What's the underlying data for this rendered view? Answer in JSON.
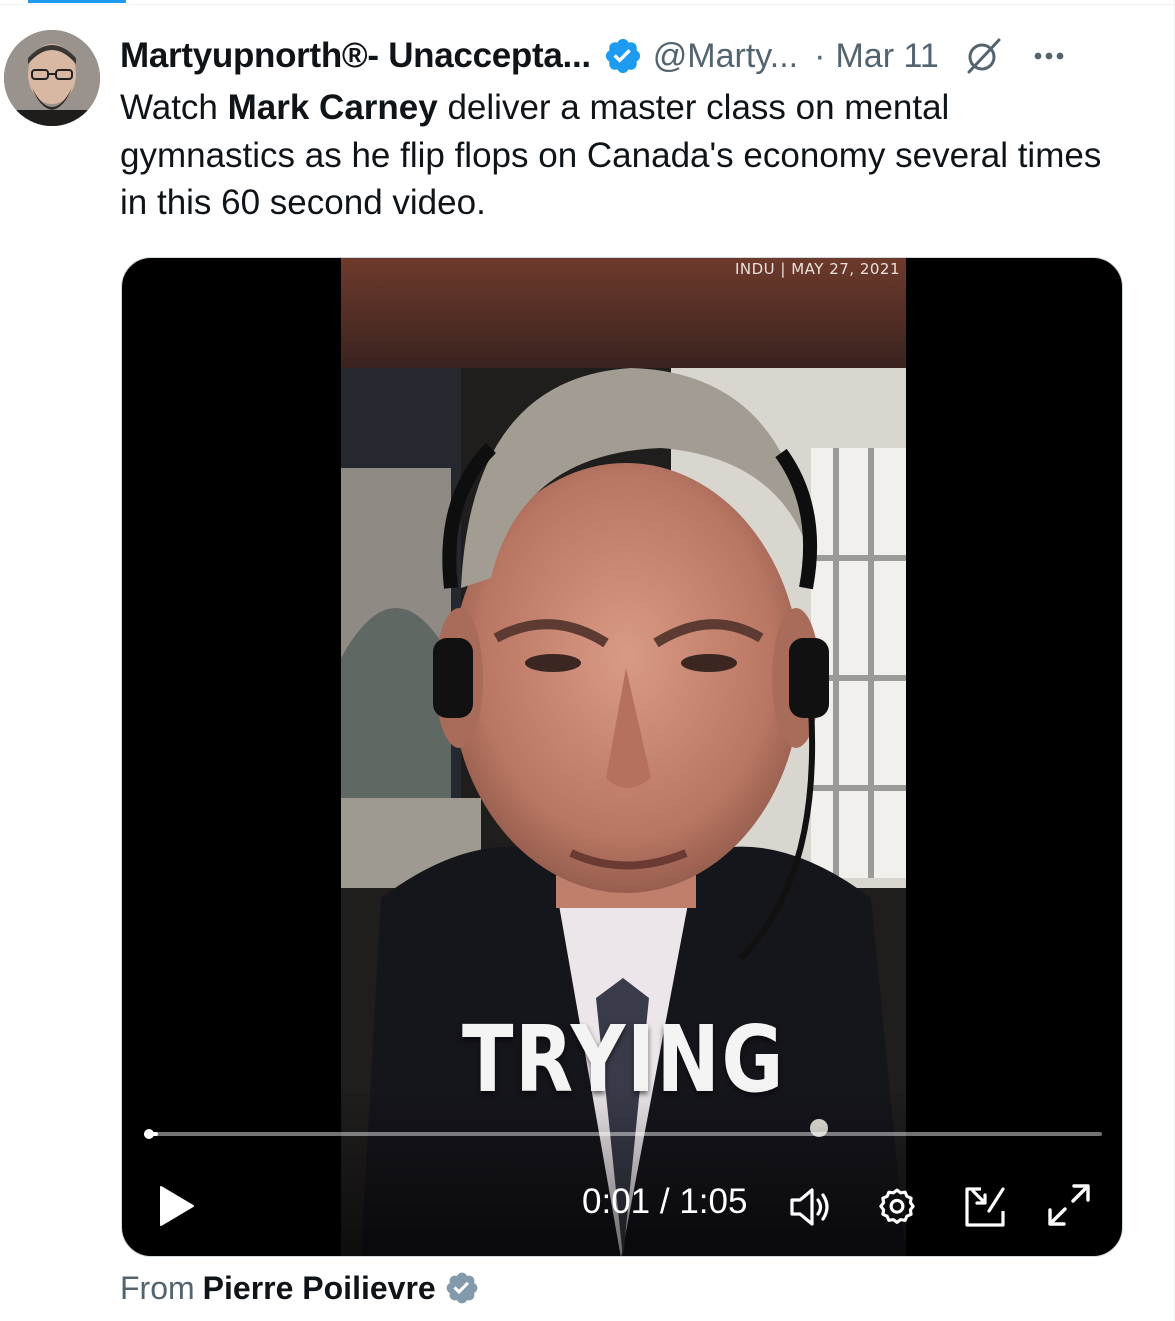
{
  "tweet": {
    "author_name": "Martyupnorth®- Unaccepta...",
    "handle": "@Marty...",
    "separator": "·",
    "date": "Mar 11",
    "text_before": "Watch ",
    "text_bold": "Mark Carney",
    "text_after": " deliver a master class on mental gymnastics as he flip flops on Canada's economy several times in this 60 second video."
  },
  "video": {
    "source_tag": "INDU | MAY 27, 2021",
    "caption_word": "TRYING",
    "current_time": "0:01",
    "time_separator": " / ",
    "duration": "1:05",
    "progress_fraction": 0.015
  },
  "attribution": {
    "from_label": "From",
    "from_name": "Pierre Poilievre"
  },
  "colors": {
    "accent_blue": "#1d9bf0",
    "muted_text": "#536471",
    "verified_gray": "#829aab"
  }
}
